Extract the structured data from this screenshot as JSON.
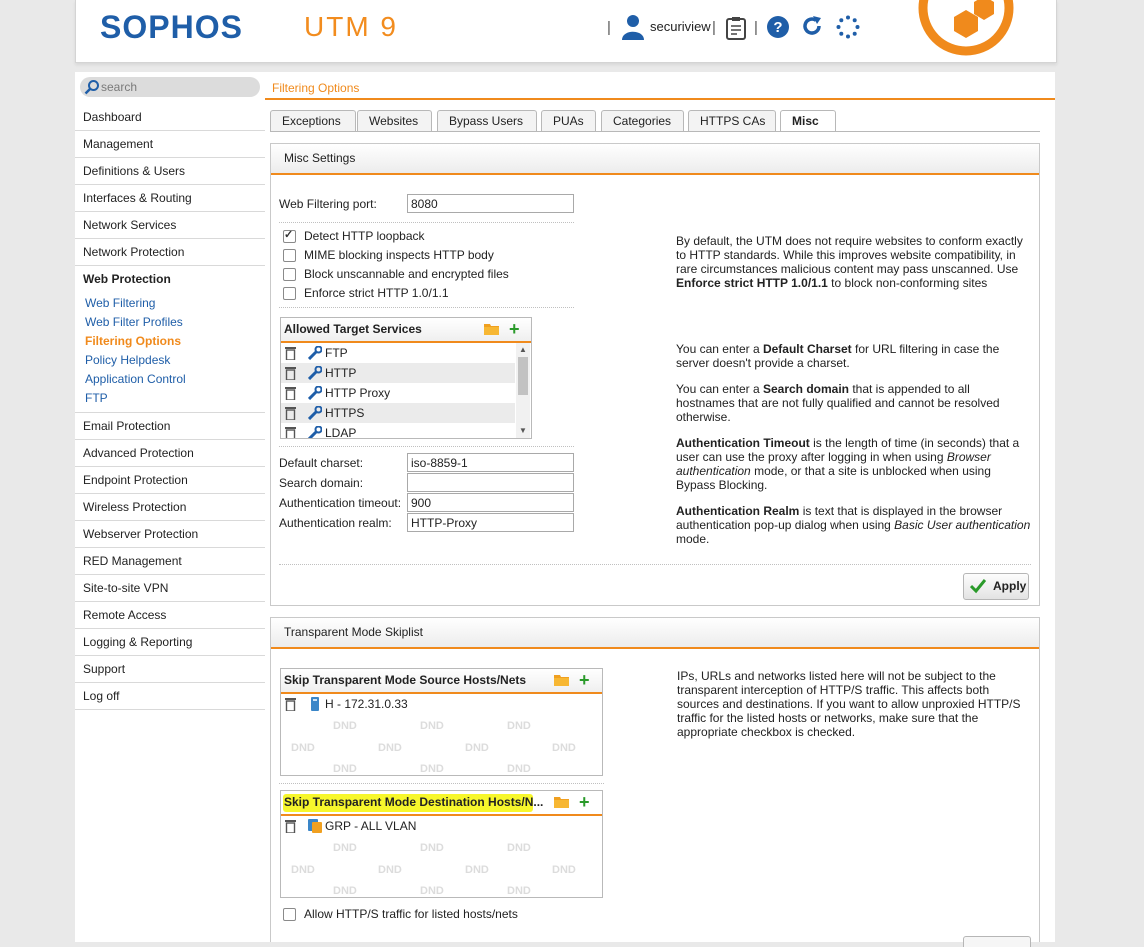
{
  "header": {
    "logo": "SOPHOS",
    "product": "UTM 9",
    "separator": "|",
    "username": "securiview",
    "icons": [
      "user-icon",
      "clipboard-icon",
      "help-icon",
      "reload-icon",
      "spinner-icon"
    ]
  },
  "sidebar": {
    "search_placeholder": "search",
    "items": [
      {
        "label": "Dashboard"
      },
      {
        "label": "Management"
      },
      {
        "label": "Definitions & Users"
      },
      {
        "label": "Interfaces & Routing"
      },
      {
        "label": "Network Services"
      },
      {
        "label": "Network Protection"
      },
      {
        "label": "Web Protection",
        "active": true
      },
      {
        "label": "Email Protection"
      },
      {
        "label": "Advanced Protection"
      },
      {
        "label": "Endpoint Protection"
      },
      {
        "label": "Wireless Protection"
      },
      {
        "label": "Webserver Protection"
      },
      {
        "label": "RED Management"
      },
      {
        "label": "Site-to-site VPN"
      },
      {
        "label": "Remote Access"
      },
      {
        "label": "Logging & Reporting"
      },
      {
        "label": "Support"
      },
      {
        "label": "Log off"
      }
    ],
    "subitems": [
      {
        "label": "Web Filtering"
      },
      {
        "label": "Web Filter Profiles"
      },
      {
        "label": "Filtering Options",
        "current": true
      },
      {
        "label": "Policy Helpdesk"
      },
      {
        "label": "Application Control"
      },
      {
        "label": "FTP"
      }
    ]
  },
  "main": {
    "page_title": "Filtering Options",
    "tabs": [
      {
        "label": "Exceptions"
      },
      {
        "label": "Websites"
      },
      {
        "label": "Bypass Users"
      },
      {
        "label": "PUAs"
      },
      {
        "label": "Categories"
      },
      {
        "label": "HTTPS CAs"
      },
      {
        "label": "Misc",
        "active": true
      }
    ],
    "misc": {
      "title": "Misc Settings",
      "port_label": "Web Filtering port:",
      "port_value": "8080",
      "checkboxes": [
        {
          "label": "Detect HTTP loopback",
          "checked": true
        },
        {
          "label": "MIME blocking inspects HTTP body",
          "checked": false
        },
        {
          "label": "Block unscannable and encrypted files",
          "checked": false
        },
        {
          "label": "Enforce strict HTTP 1.0/1.1",
          "checked": false
        }
      ],
      "services": {
        "title": "Allowed Target Services",
        "items": [
          "FTP",
          "HTTP",
          "HTTP Proxy",
          "HTTPS",
          "LDAP"
        ]
      },
      "charset_label": "Default charset:",
      "charset_value": "iso-8859-1",
      "domain_label": "Search domain:",
      "domain_value": "",
      "timeout_label": "Authentication timeout:",
      "timeout_value": "900",
      "realm_label": "Authentication realm:",
      "realm_value": "HTTP-Proxy",
      "apply_label": "Apply",
      "help": {
        "p1_a": "By default, the UTM does not require websites to conform exactly to HTTP standards. While this improves website compatibility, in rare circumstances malicious content may pass unscanned. Use ",
        "p1_b": "Enforce strict HTTP 1.0/1.1",
        "p1_c": " to block non-conforming sites",
        "p2_a": "You can enter a ",
        "p2_b": "Default Charset",
        "p2_c": " for URL filtering in case the server doesn't provide a charset.",
        "p3_a": "You can enter a ",
        "p3_b": "Search domain",
        "p3_c": " that is appended to all hostnames that are not fully qualified and cannot be resolved otherwise.",
        "p4_a": "Authentication Timeout",
        "p4_b": " is the length of time (in seconds) that a user can use the proxy after logging in when using ",
        "p4_c": "Browser authentication",
        "p4_d": " mode, or that a site is unblocked when using Bypass Blocking.",
        "p5_a": "Authentication Realm",
        "p5_b": " is text that is displayed in the browser authentication pop-up dialog when using ",
        "p5_c": "Basic User authentication",
        "p5_d": " mode."
      }
    },
    "skiplist": {
      "title": "Transparent Mode Skiplist",
      "source_title": "Skip Transparent Mode Source Hosts/Nets",
      "source_items": [
        "H - 172.31.0.33"
      ],
      "dest_title": "Skip Transparent Mode Destination Hosts/N...",
      "dest_items": [
        "GRP - ALL VLAN"
      ],
      "dnd_label": "DND",
      "allow_label": "Allow HTTP/S traffic for listed hosts/nets",
      "allow_checked": false,
      "help": "IPs, URLs and networks listed here will not be subject to the transparent interception of HTTP/S traffic. This affects both sources and destinations. If you want to allow unproxied HTTP/S traffic for the listed hosts or networks, make sure that the appropriate checkbox is checked."
    }
  },
  "colors": {
    "accent": "#f08a1c",
    "brand_blue": "#1f5ea8",
    "link_blue": "#1f5ea8",
    "add_green": "#2a9a2a",
    "highlight": "#f7f72c"
  }
}
